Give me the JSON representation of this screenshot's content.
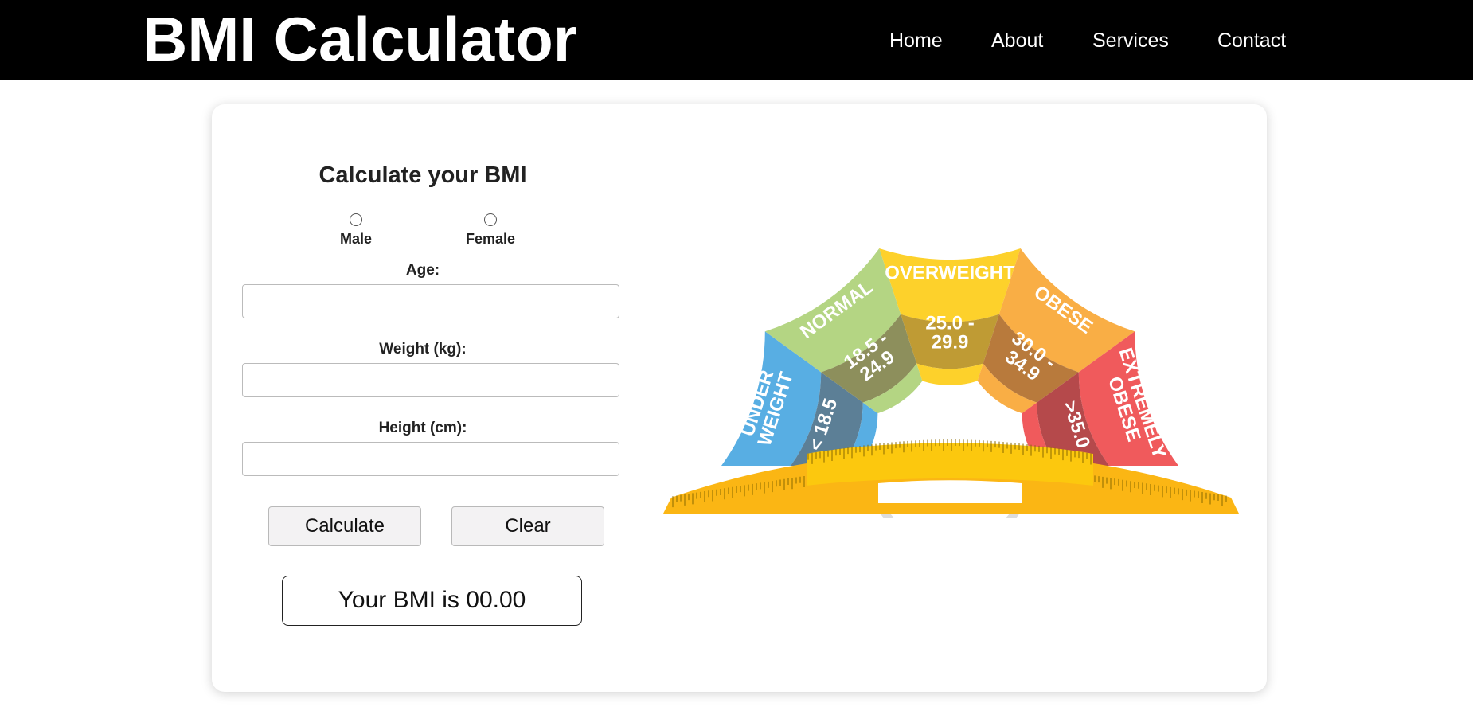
{
  "header": {
    "brand": "BMI Calculator",
    "nav": [
      {
        "label": "Home"
      },
      {
        "label": "About"
      },
      {
        "label": "Services"
      },
      {
        "label": "Contact"
      }
    ]
  },
  "form": {
    "title": "Calculate your BMI",
    "gender_options": [
      {
        "label": "Male",
        "selected": false
      },
      {
        "label": "Female",
        "selected": false
      }
    ],
    "fields": [
      {
        "label": "Age:",
        "value": "",
        "placeholder": ""
      },
      {
        "label": "Weight (kg):",
        "value": "",
        "placeholder": ""
      },
      {
        "label": "Height (cm):",
        "value": "",
        "placeholder": ""
      }
    ],
    "buttons": {
      "calculate": "Calculate",
      "clear": "Clear"
    },
    "result": "Your BMI is 00.00"
  },
  "gauge": {
    "segments": [
      {
        "category": "UNDER WEIGHT",
        "range": "< 18.5",
        "outer_color": "#58aee3",
        "inner_color": "#5c7f96"
      },
      {
        "category": "NORMAL",
        "range": "18.5 - 24.9",
        "outer_color": "#b4d583",
        "inner_color": "#8d8f5c"
      },
      {
        "category": "OVERWEIGHT",
        "range": "25.0 - 29.9",
        "outer_color": "#fdd12b",
        "inner_color": "#bf9b34"
      },
      {
        "category": "OBESE",
        "range": "30.0 - 34.9",
        "outer_color": "#f9ae45",
        "inner_color": "#b87a3c"
      },
      {
        "category": "EXTREMELY OBESE",
        "range": ">35.0",
        "outer_color": "#f05a5c",
        "inner_color": "#b5494b"
      }
    ],
    "tape_color": "#fcc80e",
    "tape_tick_color": "#8a6a00",
    "hub_ring_color": "#dcdcdc",
    "inner_band_colors": [
      "#58aee3",
      "#b4d583",
      "#fdd12b",
      "#f9ae45",
      "#f05a5c"
    ]
  }
}
